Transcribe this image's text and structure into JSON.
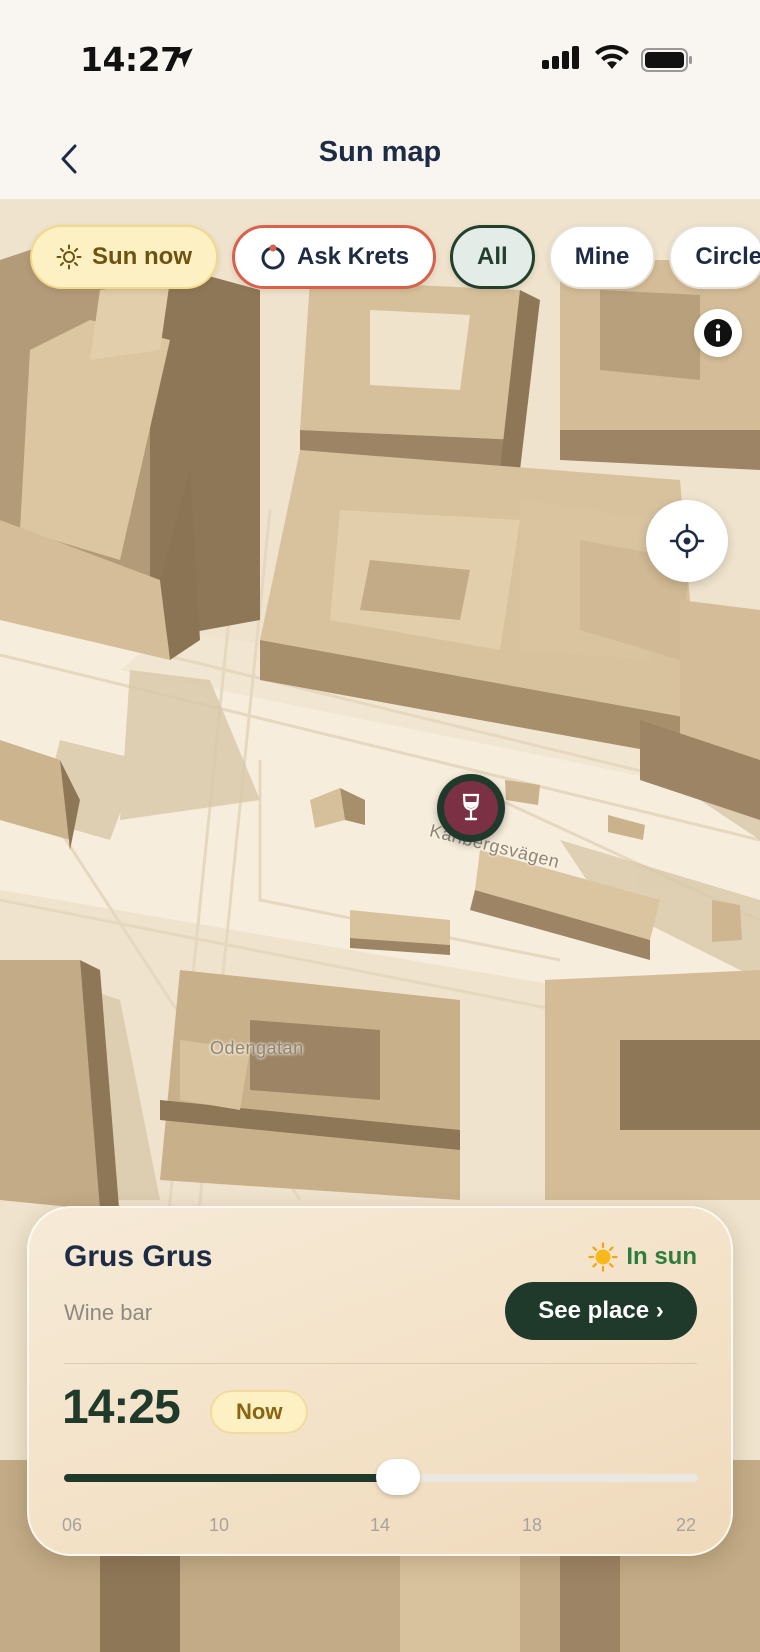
{
  "status_bar": {
    "time": "14:27"
  },
  "nav": {
    "title": "Sun map"
  },
  "filters": [
    {
      "label": "Sun now"
    },
    {
      "label": "Ask Krets"
    },
    {
      "label": "All"
    },
    {
      "label": "Mine"
    },
    {
      "label": "Circle"
    }
  ],
  "map": {
    "streets": [
      "Karlbergsvägen",
      "Odengatan"
    ],
    "marker_icon": "wine-glass-icon"
  },
  "place": {
    "name": "Grus Grus",
    "category": "Wine bar",
    "sun_status": "In sun",
    "cta": "See place ›"
  },
  "time_slider": {
    "time": "14:25",
    "badge": "Now",
    "ticks": [
      "06",
      "10",
      "14",
      "18",
      "22"
    ],
    "range_hours": [
      6,
      22
    ],
    "value_hour": 14.42
  },
  "colors": {
    "accent_dark": "#1f3a2b",
    "sun_chip": "#fdf0c2",
    "marker": "#7c3044",
    "ask_border": "#d9614c"
  }
}
